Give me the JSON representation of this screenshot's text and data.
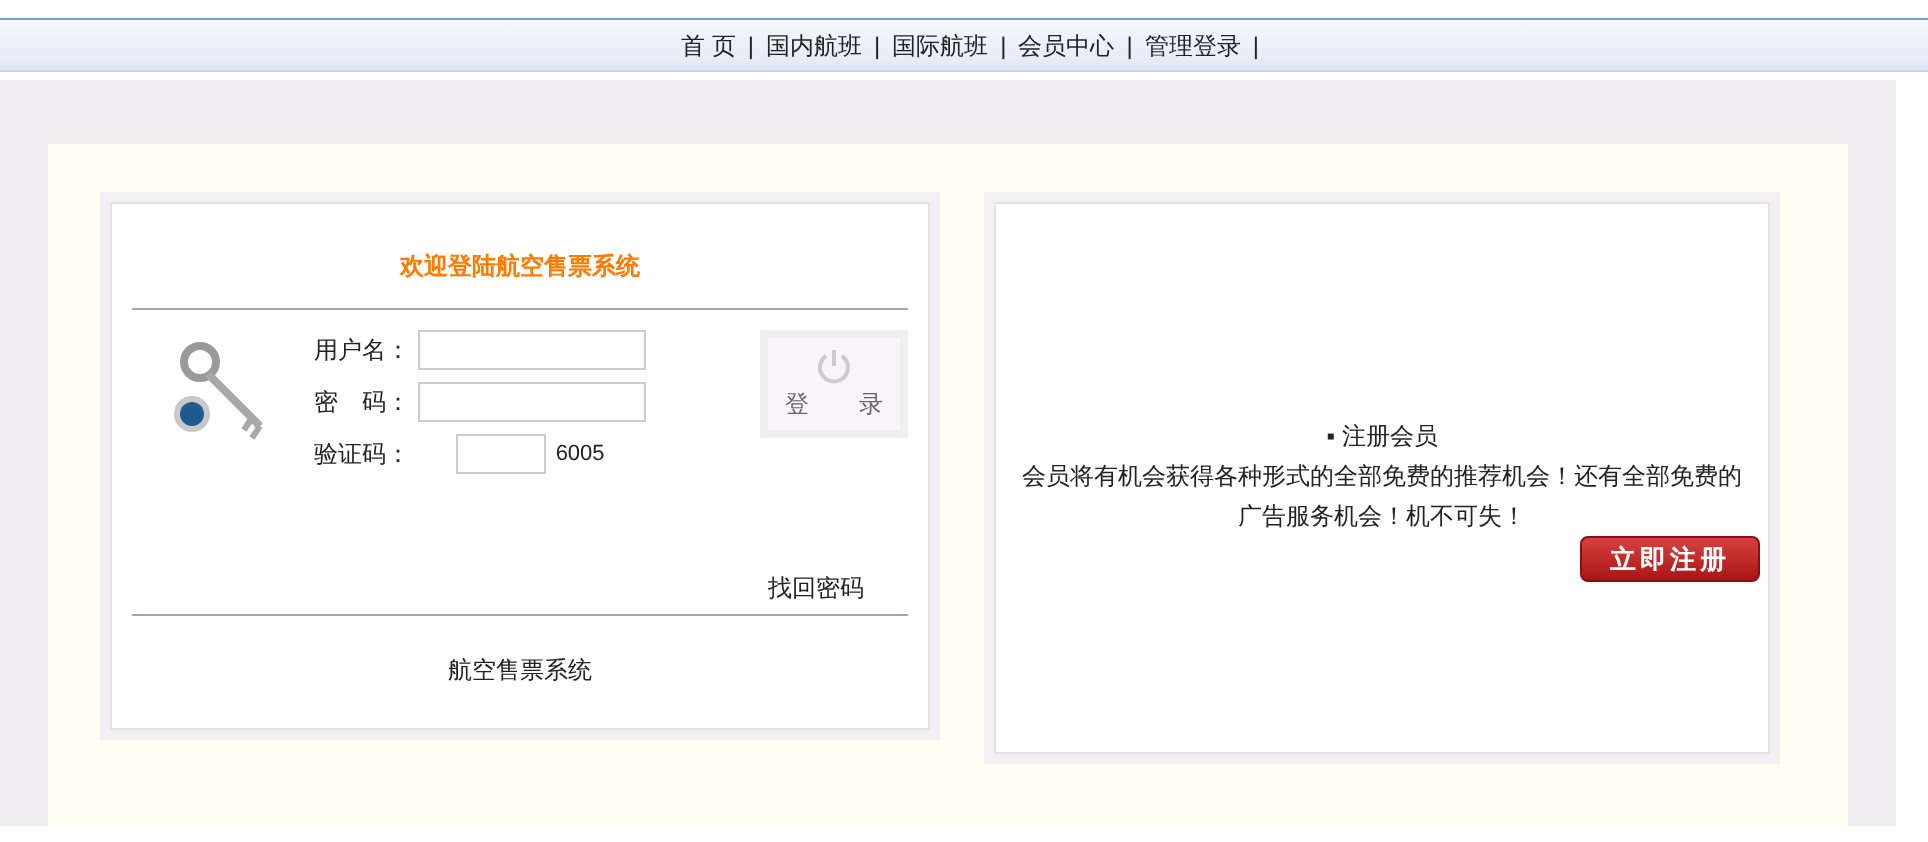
{
  "nav": {
    "separator": "|",
    "items": [
      {
        "label": "首 页"
      },
      {
        "label": "国内航班"
      },
      {
        "label": "国际航班"
      },
      {
        "label": "会员中心"
      },
      {
        "label": "管理登录"
      }
    ]
  },
  "login": {
    "title": "欢迎登陆航空售票系统",
    "fields": [
      {
        "label": "用户名：",
        "kind": "text"
      },
      {
        "label": "密　码：",
        "kind": "password"
      },
      {
        "label": "验证码：",
        "kind": "captcha",
        "code": "6005"
      }
    ],
    "button": "登 录",
    "forgot_link": "找回密码",
    "footer": "航空售票系统"
  },
  "register": {
    "heading": "▪ 注册会员",
    "text": "会员将有机会获得各种形式的全部免费的推荐机会！还有全部免费的广告服务机会！机不可失！",
    "button": "立即注册"
  }
}
